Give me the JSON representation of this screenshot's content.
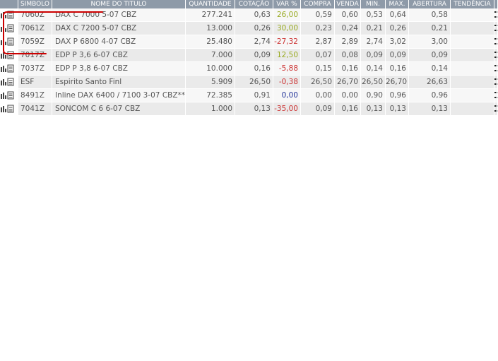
{
  "columns": [
    "SIMBOLO",
    "NOME DO TITULO",
    "QUANTIDADE",
    "COTAÇÃO",
    "VAR %",
    "COMPRA",
    "VENDA",
    "MIN.",
    "MAX.",
    "ABERTURA",
    "TENDÊNCIA"
  ],
  "rows": [
    {
      "simbolo": "7060Z",
      "nome": "DAX C 7000 5-07 CBZ",
      "quantidade": "277.241",
      "cotacao": "0,63",
      "var": "26,00",
      "var_sign": "pos",
      "compra": "0,59",
      "venda": "0,60",
      "min": "0,53",
      "max": "0,64",
      "abertura": "0,58"
    },
    {
      "simbolo": "7061Z",
      "nome": "DAX C 7200 5-07 CBZ",
      "quantidade": "13.000",
      "cotacao": "0,26",
      "var": "30,00",
      "var_sign": "pos",
      "compra": "0,23",
      "venda": "0,24",
      "min": "0,21",
      "max": "0,26",
      "abertura": "0,21"
    },
    {
      "simbolo": "7059Z",
      "nome": "DAX P 6800 4-07 CBZ",
      "quantidade": "25.480",
      "cotacao": "2,74",
      "var": "-27,32",
      "var_sign": "neg",
      "compra": "2,87",
      "venda": "2,89",
      "min": "2,74",
      "max": "3,02",
      "abertura": "3,00"
    },
    {
      "simbolo": "7017Z",
      "nome": "EDP P 3,6 6-07 CBZ",
      "quantidade": "7.000",
      "cotacao": "0,09",
      "var": "12,50",
      "var_sign": "pos",
      "compra": "0,07",
      "venda": "0,08",
      "min": "0,09",
      "max": "0,09",
      "abertura": "0,09"
    },
    {
      "simbolo": "7037Z",
      "nome": "EDP P 3,8 6-07 CBZ",
      "quantidade": "10.000",
      "cotacao": "0,16",
      "var": "-5,88",
      "var_sign": "neg",
      "compra": "0,15",
      "venda": "0,16",
      "min": "0,14",
      "max": "0,16",
      "abertura": "0,14"
    },
    {
      "simbolo": "ESF",
      "nome": "Espirito Santo Finl",
      "quantidade": "5.909",
      "cotacao": "26,50",
      "var": "-0,38",
      "var_sign": "neg",
      "compra": "26,50",
      "venda": "26,70",
      "min": "26,50",
      "max": "26,70",
      "abertura": "26,63"
    },
    {
      "simbolo": "8491Z",
      "nome": "Inline DAX 6400 / 7100 3-07 CBZ**",
      "quantidade": "72.385",
      "cotacao": "0,91",
      "var": "0,00",
      "var_sign": "zero",
      "compra": "0,00",
      "venda": "0,00",
      "min": "0,90",
      "max": "0,96",
      "abertura": "0,96"
    },
    {
      "simbolo": "7041Z",
      "nome": "SONCOM C 6 6-07 CBZ",
      "quantidade": "1.000",
      "cotacao": "0,13",
      "var": "-35,00",
      "var_sign": "neg",
      "compra": "0,09",
      "venda": "0,16",
      "min": "0,13",
      "max": "0,13",
      "abertura": "0,13"
    }
  ],
  "row_icon": "chart-and-list-icon",
  "colors": {
    "header_bg": "#8e9aa8",
    "positive": "#99aa22",
    "negative": "#cc3333",
    "neutral": "#223399",
    "annotation": "#cc0000"
  }
}
